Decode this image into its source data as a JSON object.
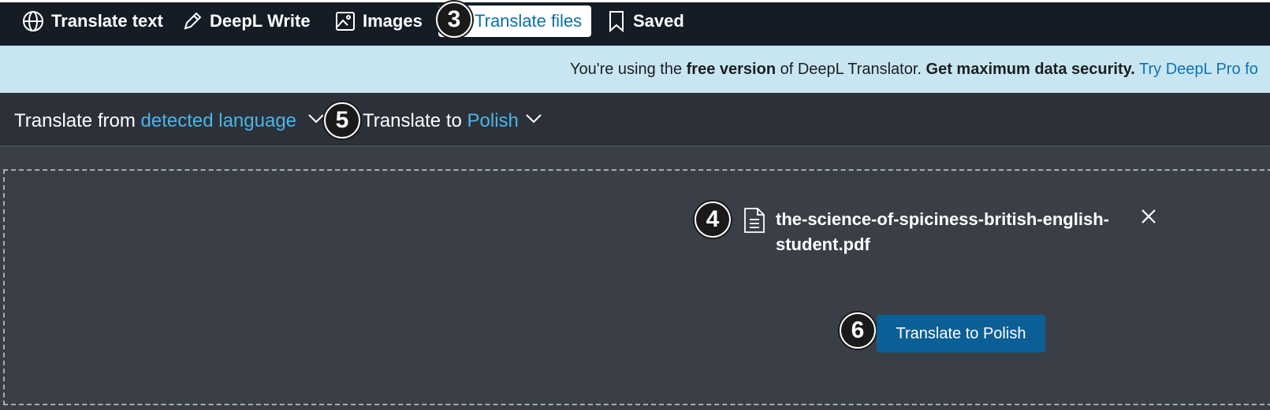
{
  "tabs": [
    {
      "label": "Translate text",
      "icon": "globe-icon"
    },
    {
      "label": "DeepL Write",
      "icon": "pencil-icon"
    },
    {
      "label": "Images",
      "icon": "image-icon"
    },
    {
      "label": "Translate files",
      "icon": "file-icon",
      "active": true
    },
    {
      "label": "Saved",
      "icon": "bookmark-icon"
    }
  ],
  "banner": {
    "part1": "You're using the ",
    "bold1": "free version",
    "part2": " of DeepL Translator. ",
    "bold2": "Get maximum data security.",
    "part3": " ",
    "link": "Try DeepL Pro fo"
  },
  "language": {
    "from_prefix": "Translate from ",
    "from_value": "detected language",
    "to_prefix": "Translate to ",
    "to_value": "Polish"
  },
  "file": {
    "name": "the-science-of-spiciness-british-english-student.pdf"
  },
  "translate_button": "Translate to Polish",
  "markers": [
    "3",
    "4",
    "5",
    "6"
  ],
  "colors": {
    "topbar": "#151c26",
    "banner": "#c8e6f1",
    "accent": "#4fb3e6",
    "button": "#0b5f96"
  }
}
